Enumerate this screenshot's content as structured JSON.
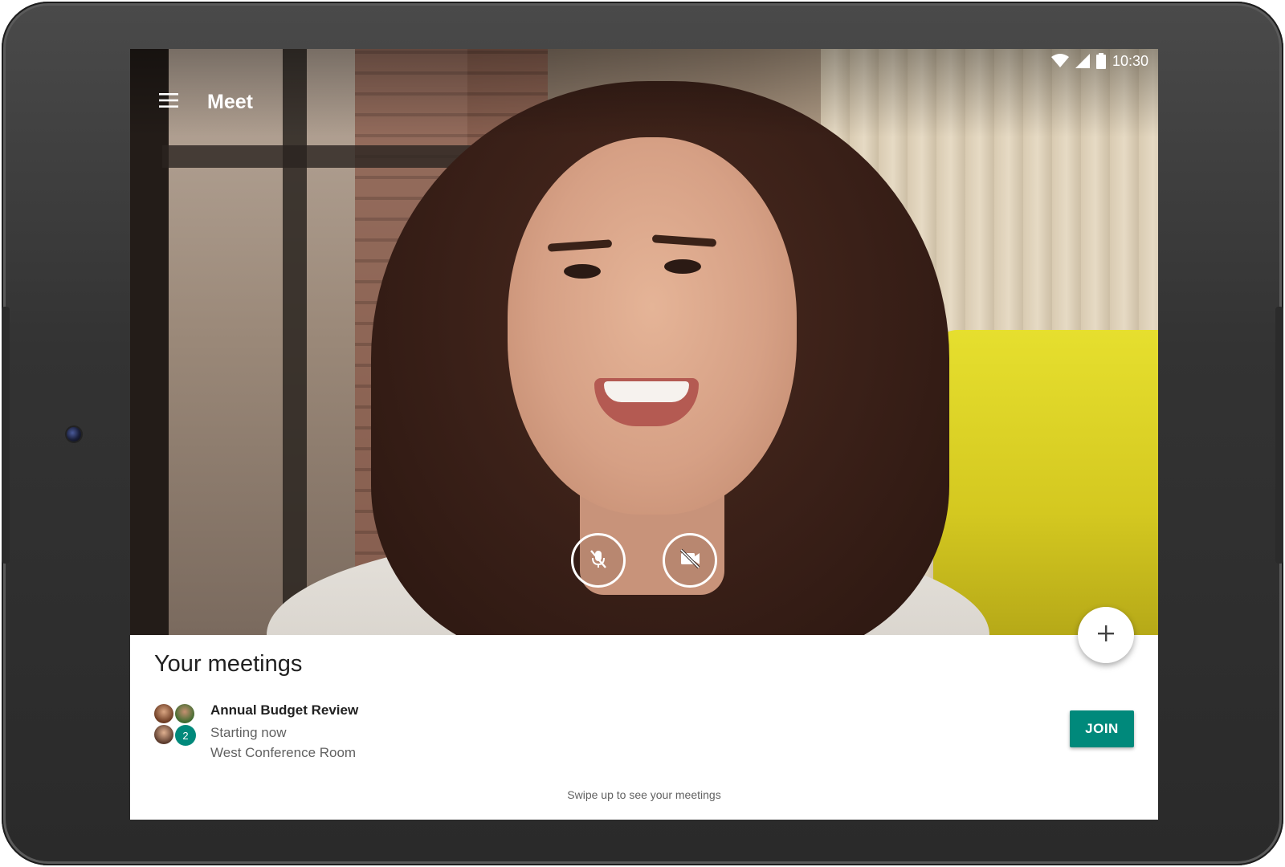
{
  "status_bar": {
    "time": "10:30",
    "icons": [
      "wifi-icon",
      "signal-icon",
      "battery-icon"
    ]
  },
  "app_bar": {
    "title": "Meet",
    "menu_icon": "hamburger-menu-icon"
  },
  "video_controls": {
    "mic_icon": "mic-off-icon",
    "camera_icon": "videocam-off-icon"
  },
  "meetings": {
    "heading": "Your meetings",
    "items": [
      {
        "name": "Annual Budget Review",
        "status": "Starting now",
        "location": "West Conference Room",
        "extra_participants": "2",
        "join_label": "JOIN"
      }
    ],
    "swipe_hint": "Swipe up to see your meetings"
  },
  "fab": {
    "icon": "plus-icon"
  },
  "colors": {
    "accent": "#00897b",
    "text_primary": "#212121",
    "text_secondary": "#616161",
    "device_bezel": "#333333"
  }
}
